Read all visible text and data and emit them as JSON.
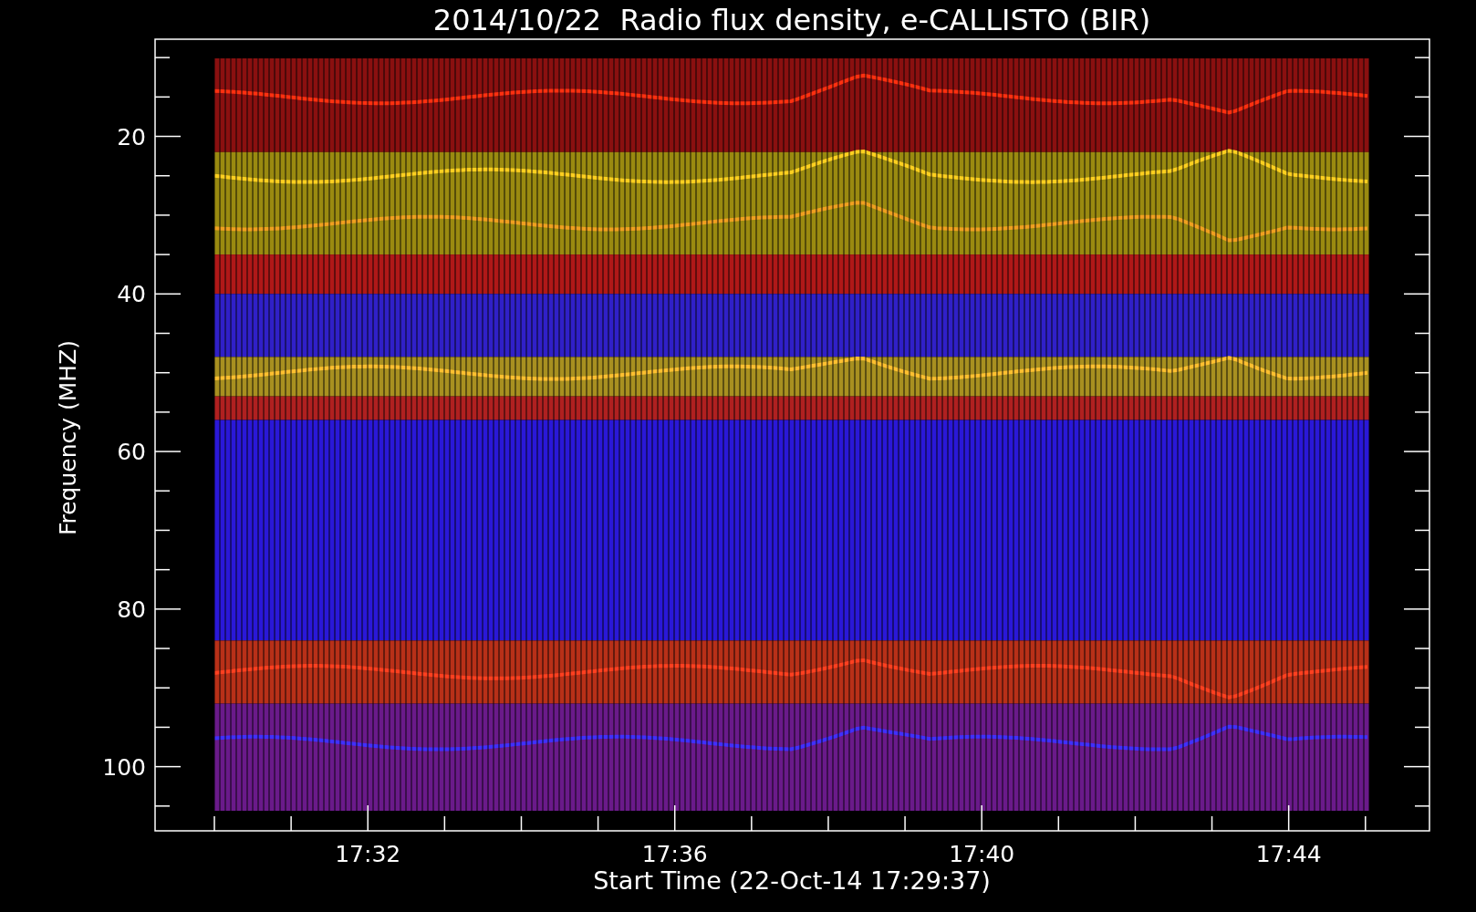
{
  "title": "2014/10/22  Radio flux density, e-CALLISTO (BIR)",
  "y_axis": {
    "label": "Frequency (MHZ)",
    "ticks": [
      "20",
      "40",
      "60",
      "80",
      "100"
    ]
  },
  "x_axis": {
    "label": "Start Time (22-Oct-14 17:29:37)",
    "ticks": [
      "17:32",
      "17:36",
      "17:40",
      "17:44"
    ]
  }
}
